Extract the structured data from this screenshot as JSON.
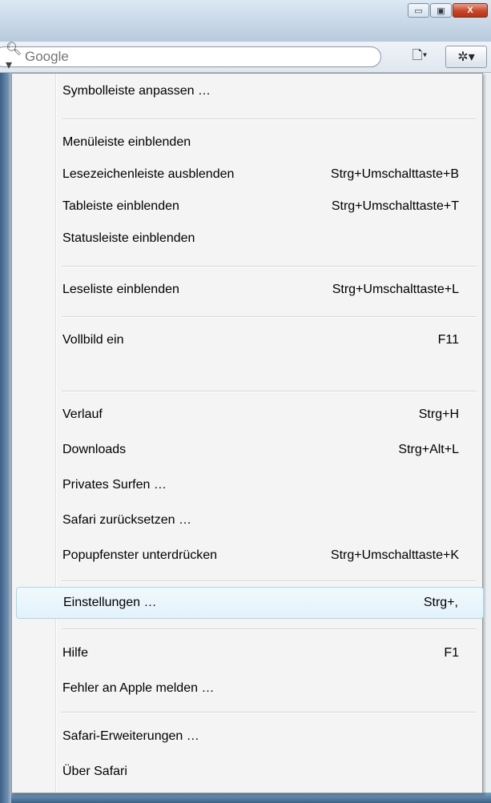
{
  "window": {
    "minimize_glyph": "▭",
    "maximize_glyph": "▣",
    "close_glyph": "X"
  },
  "toolbar": {
    "search": {
      "icon": "magnifier-icon",
      "icon_glyph": "🔍︎▾",
      "placeholder": "Google"
    },
    "page_menu_glyph": "🗋▾",
    "settings_menu_glyph": "✲▾"
  },
  "menu": {
    "items": [
      {
        "label": "Symbolleiste anpassen …",
        "shortcut": ""
      },
      {
        "label": "Menüleiste einblenden",
        "shortcut": ""
      },
      {
        "label": "Lesezeichenleiste ausblenden",
        "shortcut": "Strg+Umschalttaste+B"
      },
      {
        "label": "Tableiste einblenden",
        "shortcut": "Strg+Umschalttaste+T"
      },
      {
        "label": "Statusleiste einblenden",
        "shortcut": ""
      },
      {
        "label": "Leseliste einblenden",
        "shortcut": "Strg+Umschalttaste+L"
      },
      {
        "label": "Vollbild ein",
        "shortcut": "F11"
      },
      {
        "label": "Verlauf",
        "shortcut": "Strg+H"
      },
      {
        "label": "Downloads",
        "shortcut": "Strg+Alt+L"
      },
      {
        "label": "Privates Surfen …",
        "shortcut": ""
      },
      {
        "label": "Safari zurücksetzen …",
        "shortcut": ""
      },
      {
        "label": "Popupfenster unterdrücken",
        "shortcut": "Strg+Umschalttaste+K"
      },
      {
        "label": "Einstellungen …",
        "shortcut": "Strg+,"
      },
      {
        "label": "Hilfe",
        "shortcut": "F1"
      },
      {
        "label": "Fehler an Apple melden …",
        "shortcut": ""
      },
      {
        "label": "Safari-Erweiterungen …",
        "shortcut": ""
      },
      {
        "label": "Über Safari",
        "shortcut": ""
      }
    ]
  }
}
